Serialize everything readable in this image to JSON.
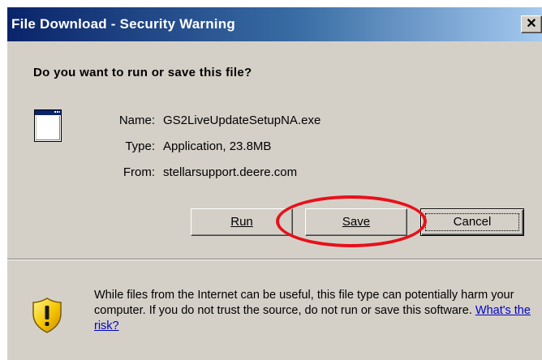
{
  "window": {
    "title": "File Download - Security Warning",
    "close_glyph": "✕"
  },
  "prompt": {
    "question": "Do you want to run or save this file?"
  },
  "file": {
    "icon": "application-window-icon",
    "name_label": "Name:",
    "name_value": "GS2LiveUpdateSetupNA.exe",
    "type_label": "Type:",
    "type_value": "Application, 23.8MB",
    "from_label": "From:",
    "from_value": "stellarsupport.deere.com"
  },
  "buttons": {
    "run_label": "Run",
    "save_label": "Save",
    "cancel_label": "Cancel"
  },
  "annotation": {
    "shape": "ellipse",
    "color": "#e8101a",
    "target": "save-button"
  },
  "warning": {
    "icon": "shield-warning-icon",
    "text": "While files from the Internet can be useful, this file type can potentially harm your computer. If you do not trust the source, do not run or save this software.",
    "link_text": "What's the risk?"
  },
  "colors": {
    "dialog_bg": "#d4d0c8",
    "titlebar_start": "#0a246a",
    "titlebar_end": "#a6caf0",
    "link": "#0000cc"
  }
}
